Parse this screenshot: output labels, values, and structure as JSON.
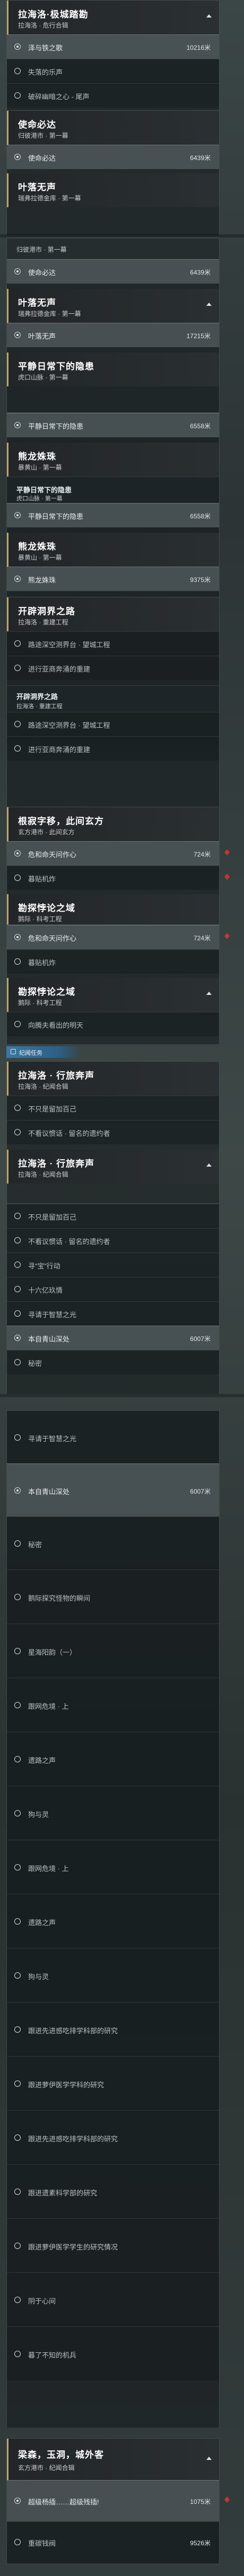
{
  "colors": {
    "accent_gold": "#c9a64b",
    "section_blue": "#3a78a3",
    "pin_red": "#c0392b"
  },
  "quests": {
    "q1": {
      "title": "拉海洛·极城踏勘",
      "sub": "拉海洛 · 危行合辑",
      "count": ""
    },
    "q1_steps": [
      {
        "label": "泽与铁之歌",
        "dist": "10216米"
      },
      {
        "label": "失落的乐声",
        "dist": ""
      },
      {
        "label": "破碎幽暗之心 - 尾声",
        "dist": ""
      }
    ],
    "q2": {
      "title": "使命必达",
      "sub": "归彼港市 · 第一幕",
      "count": ""
    },
    "q2_steps": [
      {
        "label": "使命必达",
        "dist": "6439米"
      }
    ],
    "q3": {
      "title": "叶落无声",
      "sub": "瑞弗拉德金库 · 第一幕",
      "count": ""
    },
    "q2b_sub": "归彼港市 · 第一幕",
    "q2b_steps": [
      {
        "label": "使命必达",
        "dist": "6439米"
      }
    ],
    "q3b": {
      "title": "叶落无声",
      "sub": "瑞弗拉德金库 · 第一幕",
      "count": ""
    },
    "q3_steps": [
      {
        "label": "叶落无声",
        "dist": "17215米"
      }
    ],
    "q4": {
      "title": "平静日常下的隐患",
      "sub": "虎口山脉 · 第一幕",
      "count": ""
    },
    "q4_steps": [
      {
        "label": "平静日常下的隐患",
        "dist": "6558米"
      }
    ],
    "q5": {
      "title": "熊龙姝珠",
      "sub": "暴黄山 · 第一幕",
      "count": ""
    },
    "q4b": {
      "title": "平静日常下的隐患",
      "sub": "虎口山脉 · 第一幕",
      "count": ""
    },
    "q4b_steps": [
      {
        "label": "平静日常下的隐患",
        "dist": "6558米"
      }
    ],
    "q5b": {
      "title": "熊龙姝珠",
      "sub": "暴黄山 · 第一幕",
      "count": ""
    },
    "q5_steps": [
      {
        "label": "熊龙姝珠",
        "dist": "9375米"
      }
    ],
    "q6": {
      "title": "开辟洞界之路",
      "sub": "拉海洛 · 重建工程",
      "count": ""
    },
    "q6_steps": [
      {
        "label": "路途深空测界台 · 望城工程",
        "dist": ""
      },
      {
        "label": "进行亚商奔涌的重建",
        "dist": ""
      }
    ],
    "q6b": {
      "title": "开辟洞界之路",
      "sub": "拉海洛 · 重建工程",
      "count": ""
    },
    "q6b_steps": [
      {
        "label": "路途深空测界台 · 望城工程",
        "dist": ""
      },
      {
        "label": "进行亚商奔涌的重建",
        "dist": ""
      }
    ],
    "q7": {
      "title": "根寂字移，此间玄方",
      "sub": "玄方港市 · 此间玄方",
      "count": ""
    },
    "q7_steps": [
      {
        "label": "危和命天问作心",
        "dist": "724米"
      },
      {
        "label": "暮贴机炸",
        "dist": ""
      }
    ],
    "q8": {
      "title": "勘探悖论之域",
      "sub": "鹅际 · 科考工程",
      "count": ""
    },
    "q8_steps": [
      {
        "label": "危和命天问作心",
        "dist": "724米"
      },
      {
        "label": "暮贴机炸",
        "dist": ""
      }
    ],
    "q8b": {
      "title": "勘探悖论之域",
      "sub": "鹅际 · 科考工程",
      "count": ""
    },
    "q8b_steps": [
      {
        "label": "向腾夫看出的明天",
        "dist": ""
      }
    ],
    "section_label": "纪闻任务",
    "q9": {
      "title": "拉海洛 · 行旅奔声",
      "sub": "拉海洛 · 纪闻合辑",
      "count": ""
    },
    "q9_steps": [
      {
        "label": "不只是留加百己",
        "dist": ""
      },
      {
        "label": "不看议惯话 · 留名的遗约者",
        "dist": ""
      }
    ],
    "q9b": {
      "title": "拉海洛 · 行旅奔声",
      "sub": "拉海洛 · 纪闻合辑",
      "count": ""
    },
    "q9b_steps": [
      {
        "label": "不只是留加百己",
        "dist": ""
      },
      {
        "label": "不看议惯话 · 留名的遗约者",
        "dist": ""
      },
      {
        "label": "寻“宝”行动",
        "dist": ""
      },
      {
        "label": "十六亿玖情",
        "dist": ""
      },
      {
        "label": "寻请于智慧之光",
        "dist": ""
      },
      {
        "label": "本自青山深处",
        "dist": "6007米"
      },
      {
        "label": "秘密",
        "dist": ""
      }
    ],
    "q10_steps": [
      {
        "label": "寻请于智慧之光",
        "dist": ""
      },
      {
        "label": "本自青山深处",
        "dist": "6007米"
      },
      {
        "label": "秘密",
        "dist": ""
      },
      {
        "label": "鹅际探究怪物的瞬间",
        "dist": ""
      },
      {
        "label": "星海阳韵（一）",
        "dist": ""
      },
      {
        "label": "跟网危境 · 上",
        "dist": ""
      },
      {
        "label": "遗路之声",
        "dist": ""
      },
      {
        "label": "狗与灵",
        "dist": ""
      },
      {
        "label": "跟网危境 · 上",
        "dist": ""
      },
      {
        "label": "遗路之声",
        "dist": ""
      },
      {
        "label": "狗与灵",
        "dist": ""
      },
      {
        "label": "跟进先进感吃排学科部的研究",
        "dist": ""
      },
      {
        "label": "跟进萝伊医学学科的研究",
        "dist": ""
      },
      {
        "label": "跟进先进感吃排学科部的研究",
        "dist": ""
      },
      {
        "label": "跟进遗素科学部的研究",
        "dist": ""
      },
      {
        "label": "跟进萝伊医学学生的研究情况",
        "dist": ""
      },
      {
        "label": "阴于心间",
        "dist": ""
      },
      {
        "label": "暮了不知的机兵",
        "dist": ""
      }
    ],
    "q11": {
      "title": "梁森，玉洞，城外客",
      "sub": "玄方港市 · 纪闻合辑",
      "count": ""
    },
    "q11_steps": [
      {
        "label": "超级杨插……超级残插!",
        "dist": "1075米"
      },
      {
        "label": "重碳钱阀",
        "dist": "9526米"
      }
    ]
  }
}
